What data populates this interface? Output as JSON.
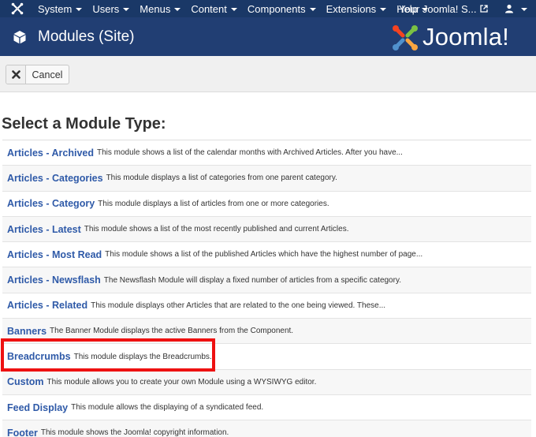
{
  "navbar": {
    "items": [
      {
        "label": "System"
      },
      {
        "label": "Users"
      },
      {
        "label": "Menus"
      },
      {
        "label": "Content"
      },
      {
        "label": "Components"
      },
      {
        "label": "Extensions"
      },
      {
        "label": "Help"
      }
    ],
    "site_link": "Your Joomla! S...",
    "user_icon": "user-icon",
    "brand_icon": "joomla-icon"
  },
  "header": {
    "title": "Modules (Site)",
    "title_icon": "cube-icon",
    "logo_text": "Joomla!",
    "logo_colors": [
      "#7ac143",
      "#f44321",
      "#f9a541",
      "#5091cd"
    ]
  },
  "toolbar": {
    "cancel_label": "Cancel",
    "cancel_icon": "close-icon"
  },
  "main": {
    "section_title": "Select a Module Type:",
    "highlighted_item": "Breadcrumbs",
    "highlight_color": "#ee1111",
    "modules": [
      {
        "name": "Articles - Archived",
        "desc": "This module shows a list of the calendar months with Archived Articles. After you have..."
      },
      {
        "name": "Articles - Categories",
        "desc": "This module displays a list of categories from one parent category."
      },
      {
        "name": "Articles - Category",
        "desc": "This module displays a list of articles from one or more categories."
      },
      {
        "name": "Articles - Latest",
        "desc": "This module shows a list of the most recently published and current Articles."
      },
      {
        "name": "Articles - Most Read",
        "desc": "This module shows a list of the published Articles which have the highest number of page..."
      },
      {
        "name": "Articles - Newsflash",
        "desc": "The Newsflash Module will display a fixed number of articles from a specific category."
      },
      {
        "name": "Articles - Related",
        "desc": "This module displays other Articles that are related to the one being viewed. These..."
      },
      {
        "name": "Banners",
        "desc": "The Banner Module displays the active Banners from the Component."
      },
      {
        "name": "Breadcrumbs",
        "desc": "This module displays the Breadcrumbs."
      },
      {
        "name": "Custom",
        "desc": "This module allows you to create your own Module using a WYSIWYG editor."
      },
      {
        "name": "Feed Display",
        "desc": "This module allows the displaying of a syndicated feed."
      },
      {
        "name": "Footer",
        "desc": "This module shows the Joomla! copyright information."
      }
    ]
  }
}
